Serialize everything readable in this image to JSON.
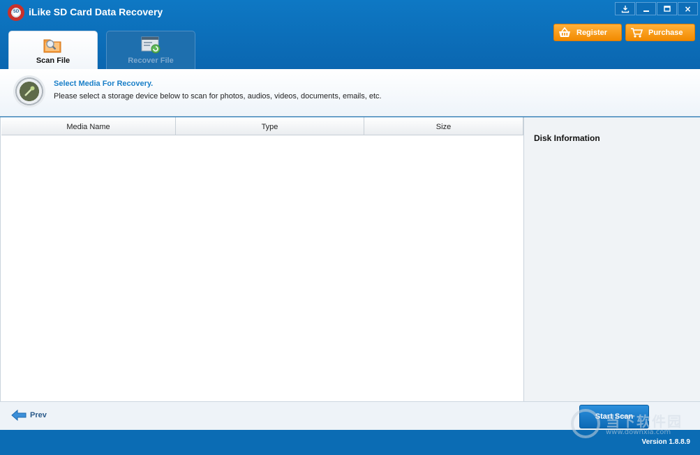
{
  "window": {
    "title": "iLike SD Card Data Recovery",
    "logo_text": "SD",
    "controls": {
      "close_label": "×"
    }
  },
  "tabs": [
    {
      "label": "Scan File",
      "active": true,
      "icon": "scan-folder-icon"
    },
    {
      "label": "Recover File",
      "active": false,
      "icon": "recover-window-icon"
    }
  ],
  "header_buttons": {
    "register_label": "Register",
    "purchase_label": "Purchase",
    "accent": "#f5910a"
  },
  "banner": {
    "title": "Select Media For Recovery.",
    "subtitle": "Please select a storage device below to scan for photos, audios, videos, documents, emails, etc."
  },
  "media_table": {
    "columns": [
      "Media Name",
      "Type",
      "Size"
    ],
    "rows": []
  },
  "disk_info": {
    "title": "Disk Information"
  },
  "navigation": {
    "prev_label": "Prev",
    "start_scan_label": "Start Scan"
  },
  "status": {
    "version": "Version 1.8.8.9"
  },
  "watermark": {
    "text": "当下软件园",
    "url": "www.downxia.com"
  },
  "colors": {
    "brand_blue": "#0b6cb4",
    "title_accent": "#1a7fc8"
  }
}
